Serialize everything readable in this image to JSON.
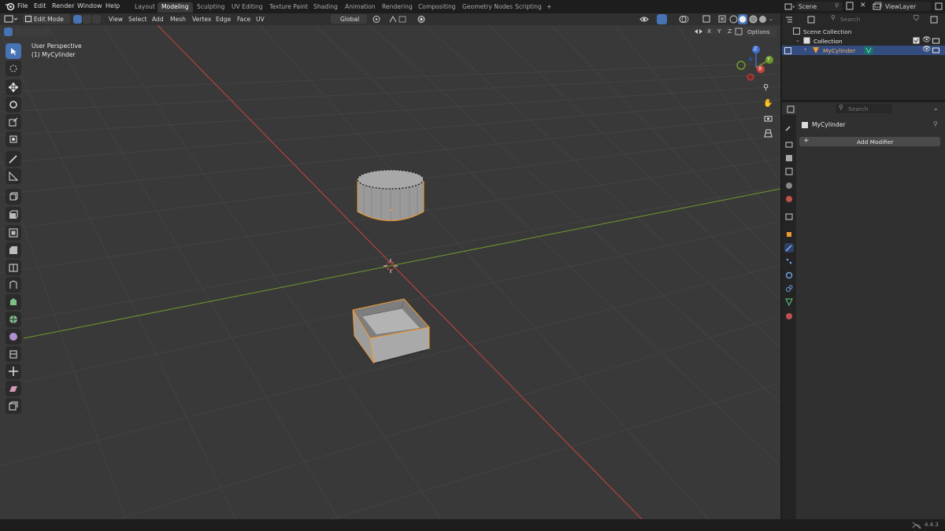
{
  "topbar": {
    "menus": [
      "File",
      "Edit",
      "Render",
      "Window",
      "Help"
    ],
    "workspaces": [
      "Layout",
      "Modeling",
      "Sculpting",
      "UV Editing",
      "Texture Paint",
      "Shading",
      "Animation",
      "Rendering",
      "Compositing",
      "Geometry Nodes",
      "Scripting"
    ],
    "active_workspace": "Modeling",
    "add_tab": "+",
    "scene": "Scene",
    "view_layer": "ViewLayer"
  },
  "viewport_header": {
    "mode": "Edit Mode",
    "menus": [
      "View",
      "Select",
      "Add",
      "Mesh",
      "Vertex",
      "Edge",
      "Face",
      "UV"
    ],
    "transform_orientation": "Global",
    "axes": [
      "X",
      "Y",
      "Z"
    ],
    "options": "Options"
  },
  "viewport": {
    "perspective": "User Perspective",
    "object": "(1) MyCylinder",
    "gizmo": {
      "z": "Z",
      "y": "Y",
      "x": "X"
    }
  },
  "outliner": {
    "search_placeholder": "Search",
    "scene_collection": "Scene Collection",
    "collection": "Collection",
    "object": "MyCylinder"
  },
  "properties": {
    "search_placeholder": "Search",
    "object": "MyCylinder",
    "add_modifier": "Add Modifier"
  },
  "status": {
    "version": "4.4.3"
  },
  "colors": {
    "accent": "#4772b3",
    "selected_edge": "#f09a30",
    "x_axis": "#c9453f",
    "y_axis": "#6f9a2b",
    "z_axis": "#3f6fd0"
  }
}
